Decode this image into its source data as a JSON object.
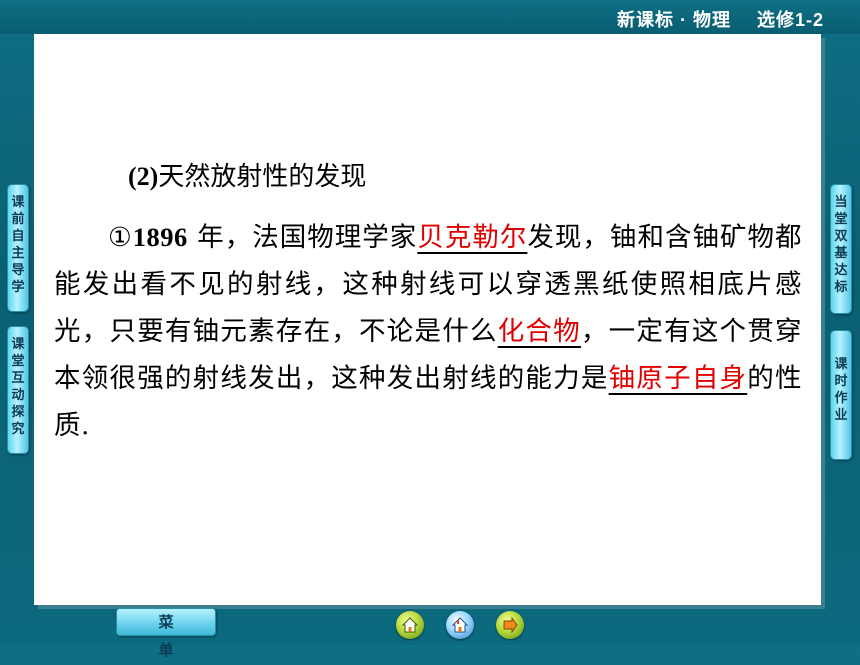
{
  "header": {
    "course": "新课标 · 物理",
    "volume": "选修1-2"
  },
  "left_nav": [
    {
      "label": "课前自主导学"
    },
    {
      "label": "课堂互动探究"
    }
  ],
  "right_nav": [
    {
      "label": "当堂双基达标"
    },
    {
      "label": "课时作业"
    }
  ],
  "content": {
    "heading_num": "(2)",
    "heading_text": "天然放射性的发现",
    "circle_num": "①",
    "year": "1896",
    "text_1": " 年，法国物理学家",
    "blank_1": "贝克勒尔",
    "text_2": "发现，铀和含铀矿物都能发出看不见的射线，这种射线可以穿透黑纸使照相底片感光，只要有铀元素存在，不论是什么",
    "blank_2": "化合物",
    "text_3": "，一定有这个贯穿本领很强的射线发出，这种发出射线的能力是",
    "blank_3": "铀原子自身",
    "text_4": "的性质."
  },
  "bottom": {
    "menu_label": "菜单",
    "icons": [
      "home-icon",
      "house-back-icon",
      "forward-icon"
    ]
  },
  "colors": {
    "background": "#0a5f73",
    "panel": "#ffffff",
    "answer_red": "#e00000"
  }
}
